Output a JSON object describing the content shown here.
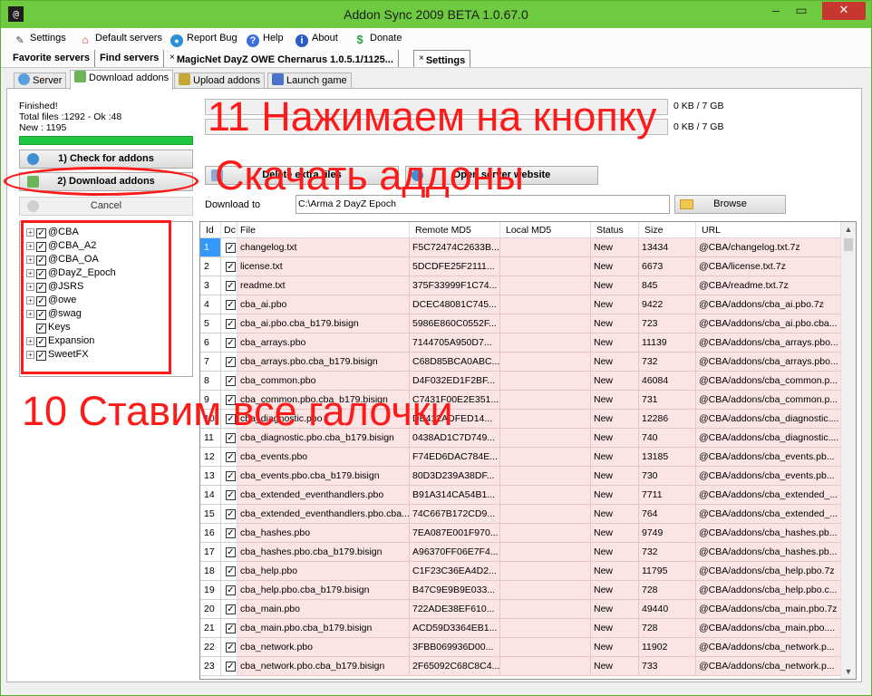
{
  "window": {
    "title": "Addon Sync 2009 BETA 1.0.67.0",
    "app_icon": "@",
    "minimize": "–",
    "maximize": "▭",
    "close": "✕"
  },
  "menu": [
    {
      "label": "Settings",
      "icon": "pencil-icon"
    },
    {
      "label": "Default servers",
      "icon": "home-icon"
    },
    {
      "label": "Report Bug",
      "icon": "globe-icon"
    },
    {
      "label": "Help",
      "icon": "help-icon"
    },
    {
      "label": "About",
      "icon": "info-icon"
    },
    {
      "label": "Donate",
      "icon": "dollar-icon"
    }
  ],
  "server_tabs": {
    "favorite": "Favorite servers",
    "find": "Find servers",
    "magicnet": "MagicNet DayZ OWE Chernarus 1.0.5.1/1125...",
    "settings": "Settings",
    "close_x": "×"
  },
  "sub_tabs": {
    "server": "Server",
    "download": "Download addons",
    "upload": "Upload addons",
    "launch": "Launch game"
  },
  "status": {
    "line1": "Finished!",
    "line2": "Total files :1292 - Ok :48",
    "line3": "New : 1195",
    "progress_percent": 100
  },
  "buttons": {
    "check": "1) Check for addons",
    "download": "2) Download addons",
    "cancel": "Cancel",
    "delete_extra": "Delete extra files",
    "open_site": "Open server website",
    "browse": "Browse"
  },
  "kb_labels": {
    "top": "0 KB / 7 GB",
    "bottom": "0 KB / 7 GB"
  },
  "download_to": {
    "label": "Download to",
    "value": "C:\\Arma 2 DayZ Epoch"
  },
  "tree": [
    {
      "label": "@CBA",
      "expandable": true,
      "checked": true
    },
    {
      "label": "@CBA_A2",
      "expandable": true,
      "checked": true
    },
    {
      "label": "@CBA_OA",
      "expandable": true,
      "checked": true
    },
    {
      "label": "@DayZ_Epoch",
      "expandable": true,
      "checked": true
    },
    {
      "label": "@JSRS",
      "expandable": true,
      "checked": true
    },
    {
      "label": "@owe",
      "expandable": true,
      "checked": true
    },
    {
      "label": "@swag",
      "expandable": true,
      "checked": true
    },
    {
      "label": "Keys",
      "expandable": false,
      "checked": true
    },
    {
      "label": "Expansion",
      "expandable": true,
      "checked": true
    },
    {
      "label": "SweetFX",
      "expandable": true,
      "checked": true
    }
  ],
  "grid": {
    "columns": [
      "Id",
      "Dc",
      "File",
      "Remote MD5",
      "Local MD5",
      "Status",
      "Size",
      "URL"
    ],
    "check_mark": "✓",
    "rows": [
      {
        "id": "1",
        "file": "changelog.txt",
        "md5": "F5C72474C2633B...",
        "status": "New",
        "size": "13434",
        "url": "@CBA/changelog.txt.7z"
      },
      {
        "id": "2",
        "file": "license.txt",
        "md5": "5DCDFE25F2111...",
        "status": "New",
        "size": "6673",
        "url": "@CBA/license.txt.7z"
      },
      {
        "id": "3",
        "file": "readme.txt",
        "md5": "375F33999F1C74...",
        "status": "New",
        "size": "845",
        "url": "@CBA/readme.txt.7z"
      },
      {
        "id": "4",
        "file": "cba_ai.pbo",
        "md5": "DCEC48081C745...",
        "status": "New",
        "size": "9422",
        "url": "@CBA/addons/cba_ai.pbo.7z"
      },
      {
        "id": "5",
        "file": "cba_ai.pbo.cba_b179.bisign",
        "md5": "5986E860C0552F...",
        "status": "New",
        "size": "723",
        "url": "@CBA/addons/cba_ai.pbo.cba..."
      },
      {
        "id": "6",
        "file": "cba_arrays.pbo",
        "md5": "7144705A950D7...",
        "status": "New",
        "size": "11139",
        "url": "@CBA/addons/cba_arrays.pbo..."
      },
      {
        "id": "7",
        "file": "cba_arrays.pbo.cba_b179.bisign",
        "md5": "C68D85BCA0ABC...",
        "status": "New",
        "size": "732",
        "url": "@CBA/addons/cba_arrays.pbo..."
      },
      {
        "id": "8",
        "file": "cba_common.pbo",
        "md5": "D4F032ED1F2BF...",
        "status": "New",
        "size": "46084",
        "url": "@CBA/addons/cba_common.p..."
      },
      {
        "id": "9",
        "file": "cba_common.pbo.cba_b179.bisign",
        "md5": "C7431F00E2E351...",
        "status": "New",
        "size": "731",
        "url": "@CBA/addons/cba_common.p..."
      },
      {
        "id": "10",
        "file": "cba_diagnostic.pbo",
        "md5": "DE412ADFED14...",
        "status": "New",
        "size": "12286",
        "url": "@CBA/addons/cba_diagnostic...."
      },
      {
        "id": "11",
        "file": "cba_diagnostic.pbo.cba_b179.bisign",
        "md5": "0438AD1C7D749...",
        "status": "New",
        "size": "740",
        "url": "@CBA/addons/cba_diagnostic...."
      },
      {
        "id": "12",
        "file": "cba_events.pbo",
        "md5": "F74ED6DAC784E...",
        "status": "New",
        "size": "13185",
        "url": "@CBA/addons/cba_events.pb..."
      },
      {
        "id": "13",
        "file": "cba_events.pbo.cba_b179.bisign",
        "md5": "80D3D239A38DF...",
        "status": "New",
        "size": "730",
        "url": "@CBA/addons/cba_events.pb..."
      },
      {
        "id": "14",
        "file": "cba_extended_eventhandlers.pbo",
        "md5": "B91A314CA54B1...",
        "status": "New",
        "size": "7711",
        "url": "@CBA/addons/cba_extended_..."
      },
      {
        "id": "15",
        "file": "cba_extended_eventhandlers.pbo.cba...",
        "md5": "74C667B172CD9...",
        "status": "New",
        "size": "764",
        "url": "@CBA/addons/cba_extended_..."
      },
      {
        "id": "16",
        "file": "cba_hashes.pbo",
        "md5": "7EA087E001F970...",
        "status": "New",
        "size": "9749",
        "url": "@CBA/addons/cba_hashes.pb..."
      },
      {
        "id": "17",
        "file": "cba_hashes.pbo.cba_b179.bisign",
        "md5": "A96370FF06E7F4...",
        "status": "New",
        "size": "732",
        "url": "@CBA/addons/cba_hashes.pb..."
      },
      {
        "id": "18",
        "file": "cba_help.pbo",
        "md5": "C1F23C36EA4D2...",
        "status": "New",
        "size": "11795",
        "url": "@CBA/addons/cba_help.pbo.7z"
      },
      {
        "id": "19",
        "file": "cba_help.pbo.cba_b179.bisign",
        "md5": "B47C9E9B9E033...",
        "status": "New",
        "size": "728",
        "url": "@CBA/addons/cba_help.pbo.c..."
      },
      {
        "id": "20",
        "file": "cba_main.pbo",
        "md5": "722ADE38EF610...",
        "status": "New",
        "size": "49440",
        "url": "@CBA/addons/cba_main.pbo.7z"
      },
      {
        "id": "21",
        "file": "cba_main.pbo.cba_b179.bisign",
        "md5": "ACD59D3364EB1...",
        "status": "New",
        "size": "728",
        "url": "@CBA/addons/cba_main.pbo...."
      },
      {
        "id": "22",
        "file": "cba_network.pbo",
        "md5": "3FBB069936D00...",
        "status": "New",
        "size": "11902",
        "url": "@CBA/addons/cba_network.p..."
      },
      {
        "id": "23",
        "file": "cba_network.pbo.cba_b179.bisign",
        "md5": "2F65092C68C8C4...",
        "status": "New",
        "size": "733",
        "url": "@CBA/addons/cba_network.p..."
      }
    ]
  },
  "annotations": {
    "step11_line1": "11 Нажимаем на кнопку",
    "step11_line2": "Скачать аддоны",
    "step10": "10 Ставим все галочки",
    "color": "#ff1a1a"
  },
  "colors": {
    "titlebar": "#6ecb3f",
    "row_highlight": "#fbe4e4",
    "selection": "#3399ff",
    "progress": "#1ec73f"
  }
}
